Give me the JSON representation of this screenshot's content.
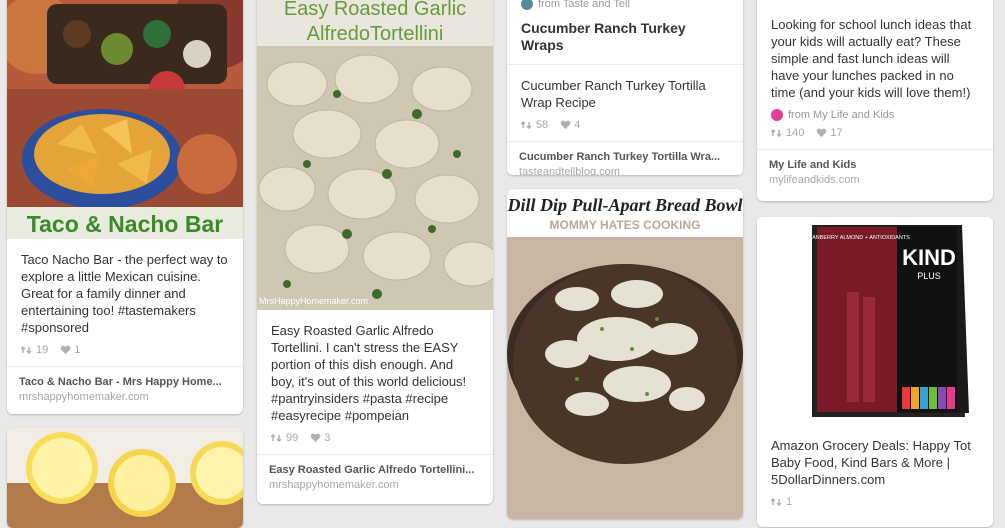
{
  "icons": {
    "repin": "repin-icon",
    "like": "heart-icon"
  },
  "pins": [
    {
      "image_caption": "Taco & Nacho Bar",
      "description": "Taco Nacho Bar - the perfect way to explore a little Mexican cuisine. Great for a family dinner and entertaining too! #tastemakers #sponsored",
      "repins": "19",
      "likes": "1",
      "attribution_title": "Taco & Nacho Bar - Mrs Happy Home...",
      "attribution_domain": "mrshappyhomemaker.com"
    },
    {
      "image_caption": "",
      "description": "",
      "repins": "",
      "likes": "",
      "attribution_title": "",
      "attribution_domain": ""
    },
    {
      "image_caption_line1": "Easy Roasted Garlic",
      "image_caption_line2": "AlfredoTortellini",
      "image_watermark": "MrsHappyHomemaker.com",
      "description": "Easy Roasted Garlic Alfredo Tortellini. I can't stress the EASY portion of this dish enough. And boy, it's out of this world delicious! #pantryinsiders #pasta #recipe #easyrecipe #pompeian",
      "repins": "99",
      "likes": "3",
      "attribution_title": "Easy Roasted Garlic Alfredo Tortellini...",
      "attribution_domain": "mrshappyhomemaker.com"
    },
    {
      "source_text": "from Taste and Tell",
      "title": "Cucumber Ranch Turkey Wraps",
      "description": "Cucumber Ranch Turkey Tortilla Wrap Recipe",
      "repins": "58",
      "likes": "4",
      "attribution_title": "Cucumber Ranch Turkey Tortilla Wra...",
      "attribution_domain": "tasteandtellblog.com"
    },
    {
      "image_caption_line1": "Dill Dip Pull-Apart Bread Bowl",
      "image_caption_line2": "MOMMY HATES COOKING"
    },
    {
      "description": "Looking for school lunch ideas that your kids will actually eat? These simple and fast lunch ideas will have your lunches packed in no time (and your kids will love them!)",
      "source_text": "from My Life and Kids",
      "repins": "140",
      "likes": "17",
      "attribution_title": "My Life and Kids",
      "attribution_domain": "mylifeandkids.com"
    },
    {
      "box_brand": "KIND",
      "box_plus": "PLUS",
      "box_flavor": "CRANBERRY ALMOND + ANTIOXIDANTS",
      "description": "Amazon Grocery Deals: Happy Tot Baby Food, Kind Bars & More | 5DollarDinners.com",
      "repins": "1"
    }
  ]
}
